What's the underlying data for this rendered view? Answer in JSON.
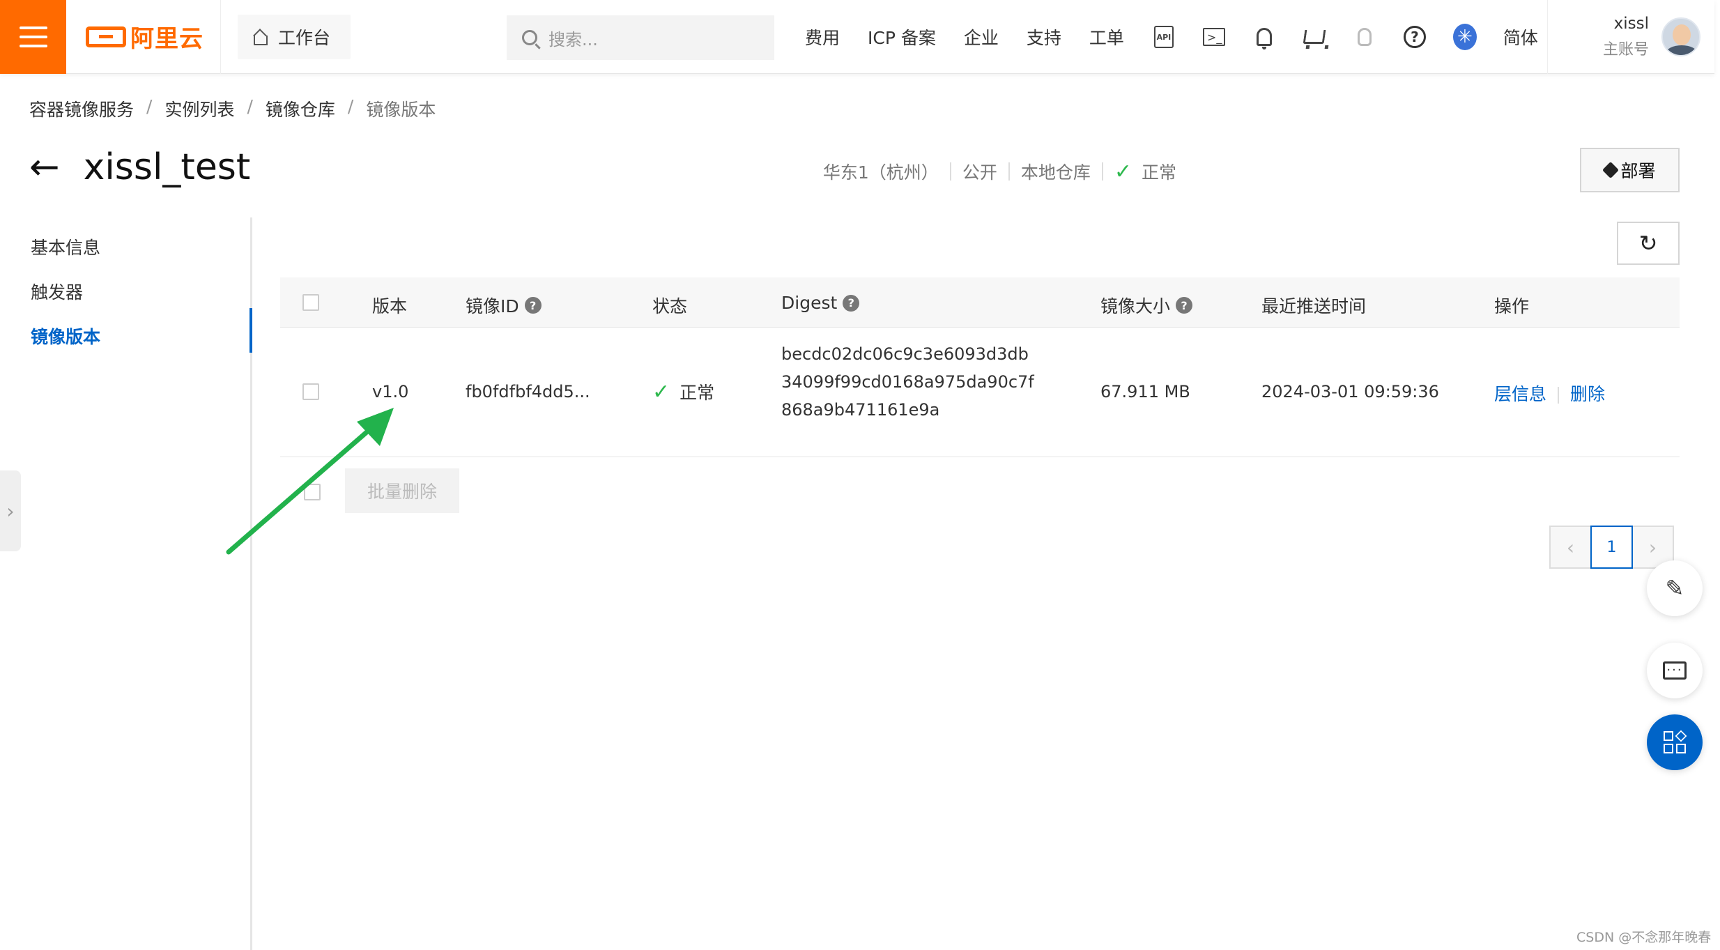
{
  "header": {
    "brand": "阿里云",
    "workbench_label": "工作台",
    "search_placeholder": "搜索...",
    "nav": [
      "费用",
      "ICP 备案",
      "企业",
      "支持",
      "工单"
    ],
    "api_icon_text": "API",
    "lang_label": "简体",
    "user_name": "xissl",
    "user_role": "主账号",
    "accent_color": "#ff6a00"
  },
  "breadcrumb": [
    "容器镜像服务",
    "实例列表",
    "镜像仓库",
    "镜像版本"
  ],
  "page": {
    "title": "xissl_test",
    "region": "华东1（杭州）",
    "visibility": "公开",
    "repo_type": "本地仓库",
    "status": "正常",
    "deploy_label": "部署"
  },
  "sidebar": {
    "items": [
      {
        "label": "基本信息",
        "active": false
      },
      {
        "label": "触发器",
        "active": false
      },
      {
        "label": "镜像版本",
        "active": true
      }
    ]
  },
  "table": {
    "columns": {
      "version": "版本",
      "image_id": "镜像ID",
      "status": "状态",
      "digest": "Digest",
      "size": "镜像大小",
      "pushed_at": "最近推送时间",
      "actions": "操作"
    },
    "rows": [
      {
        "version": "v1.0",
        "image_id": "fb0fdfbf4dd5...",
        "status": "正常",
        "digest_lines": [
          "becdc02dc06c9c3e6093d3db",
          "34099f99cd0168a975da90c7f",
          "868a9b471161e9a"
        ],
        "size": "67.911 MB",
        "pushed_at": "2024-03-01 09:59:36",
        "actions": [
          "层信息",
          "删除"
        ]
      }
    ],
    "batch_delete_label": "批量删除"
  },
  "pagination": {
    "current_page": "1",
    "prev": "‹",
    "next": "›"
  },
  "watermark": "CSDN @不念那年晚春",
  "colors": {
    "link": "#0064c8",
    "success": "#2db84d",
    "annotation_arrow": "#22b24c"
  }
}
